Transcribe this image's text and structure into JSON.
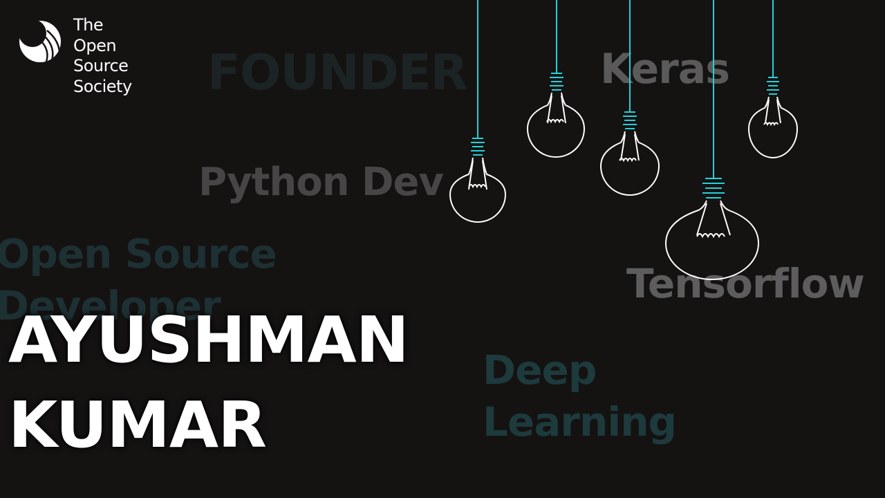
{
  "colors": {
    "background": "#151212",
    "cord": "#22d3dc",
    "bulb_outline": "#ffffff",
    "name_text": "#ffffff"
  },
  "logo": {
    "icon": "open-source-society-logo-icon",
    "line1": "The",
    "line2": "Open",
    "line3": "Source",
    "line4": "Society"
  },
  "background_words": {
    "founder": "FOUNDER",
    "keras": "Keras",
    "python": "Python Dev",
    "open_source": "Open Source",
    "developer": "Developer",
    "tensorflow": "Tensorflow",
    "deep": "Deep",
    "learning": "Learning"
  },
  "name": {
    "first": "AYUSHMAN",
    "last": "KUMAR"
  },
  "decor": {
    "icon": "hanging-lightbulb-icon"
  }
}
